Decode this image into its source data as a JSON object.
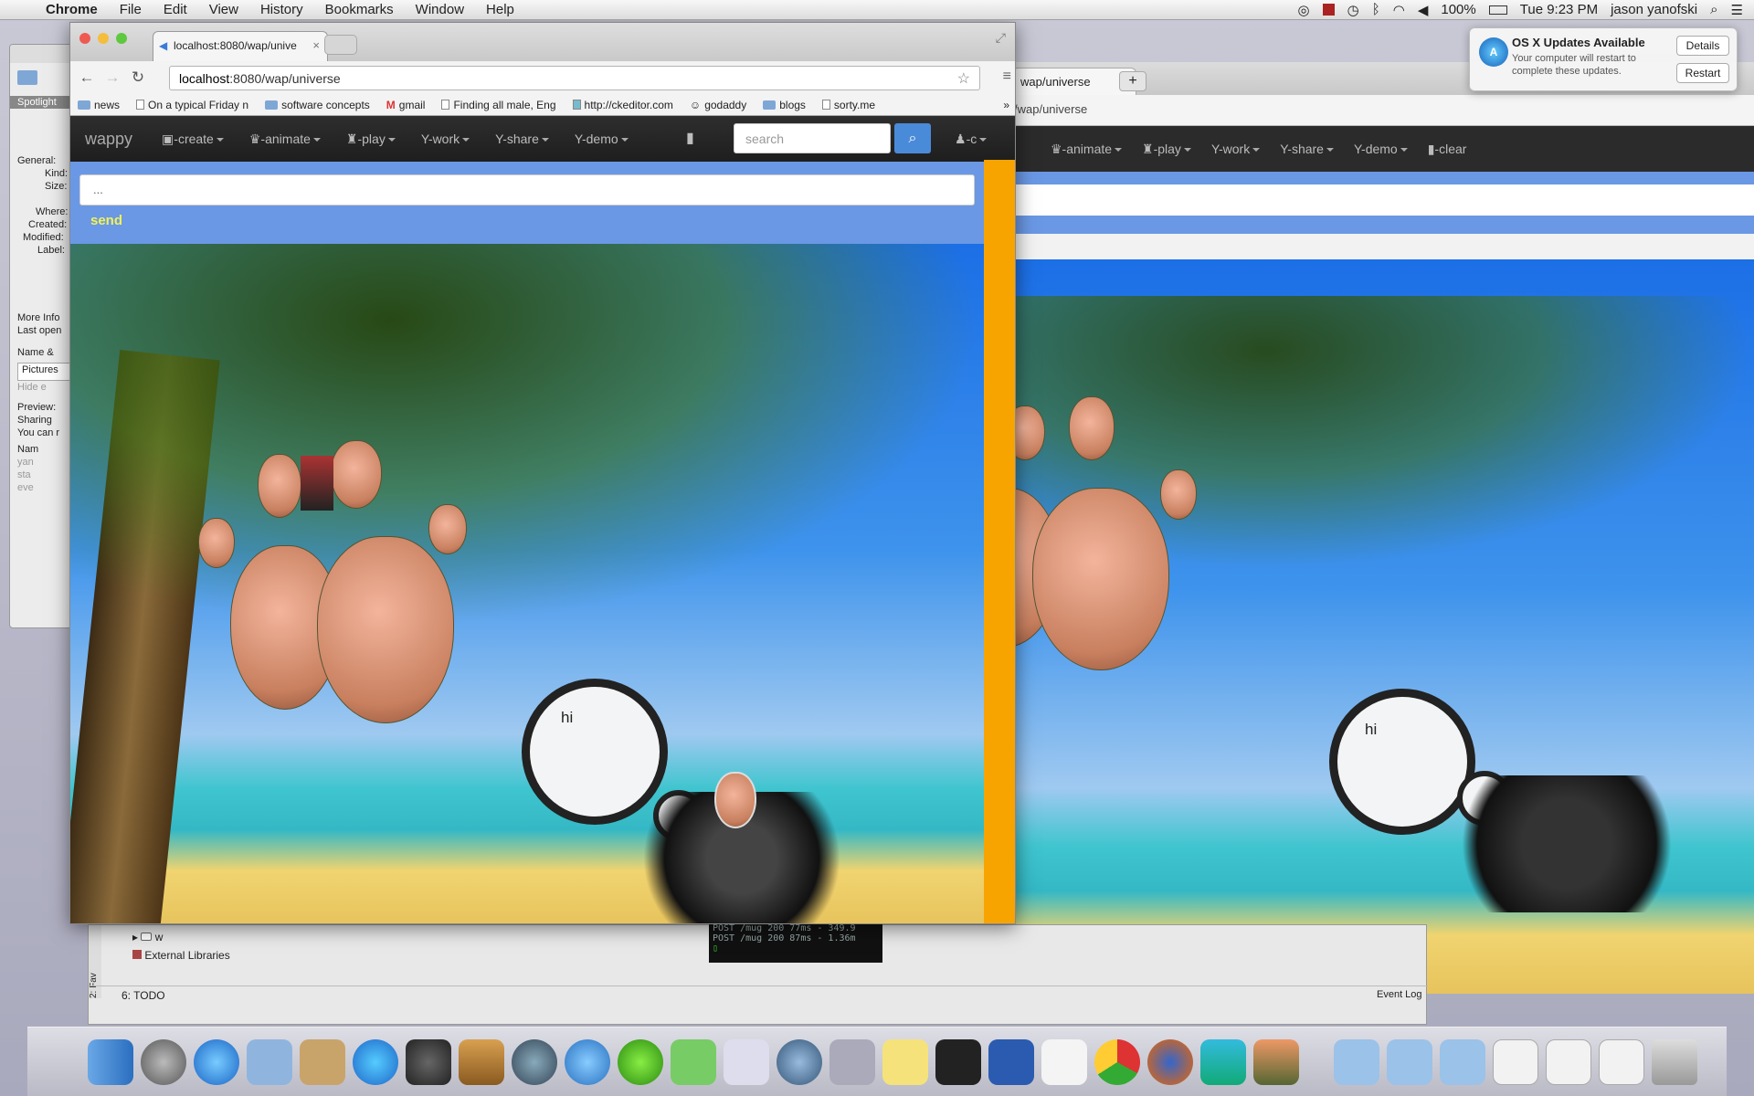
{
  "menubar": {
    "app": "Chrome",
    "items": [
      "File",
      "Edit",
      "View",
      "History",
      "Bookmarks",
      "Window",
      "Help"
    ],
    "battery": "100%",
    "clock": "Tue 9:23 PM",
    "user": "jason yanofski"
  },
  "notification": {
    "title": "OS X Updates Available",
    "body": "Your computer will restart to complete these updates.",
    "details": "Details",
    "restart": "Restart"
  },
  "infowin": {
    "lines": [
      "Spotlight",
      "General:",
      "Kind:",
      "Size:",
      "Where:",
      "Created:",
      "Modified:",
      "Label:",
      "More Info",
      "Last open",
      "Name &",
      "Pictures",
      "Hide e",
      "Preview:",
      "Sharing",
      "You can r",
      "Nam",
      "yan",
      "sta",
      "eve"
    ]
  },
  "browser": {
    "tab_title": "localhost:8080/wap/unive",
    "url_host": "localhost",
    "url_path": ":8080/wap/universe",
    "bookmarks": [
      "news",
      "On a typical Friday n",
      "software concepts",
      "gmail",
      "Finding all male, Eng",
      "http://ckeditor.com",
      "godaddy",
      "blogs",
      "sorty.me"
    ]
  },
  "app": {
    "brand": "wappy",
    "nav": [
      "create",
      "animate",
      "play",
      "work",
      "share",
      "demo"
    ],
    "search_placeholder": "search",
    "user": "c",
    "message_placeholder": "...",
    "send": "send",
    "bubble_text": "hi"
  },
  "backwin": {
    "tab_title": "wap/universe",
    "url": "/wap/universe",
    "nav": [
      "animate",
      "play",
      "work",
      "share",
      "demo",
      "clear"
    ],
    "bubble_text": "hi"
  },
  "terminal": {
    "lines": [
      "POST /mug 200 77ms - 349.9",
      "POST /mug 200 87ms - 1.36m"
    ]
  },
  "ide": {
    "tree_item": "w",
    "libraries": "External Libraries",
    "todo": "6: TODO",
    "event_log": "Event Log",
    "favorites": "2: Fav"
  },
  "dock": [
    "finder",
    "launchpad",
    "app-store",
    "mail-stamp",
    "contacts",
    "itunes",
    "imovie",
    "garageband",
    "time-machine",
    "messages",
    "green-app",
    "network",
    "preview",
    "network-utility",
    "hp-printer",
    "stickies",
    "terminal",
    "word",
    "reminders",
    "chrome",
    "firefox",
    "webstorm",
    "iphoto",
    "downloads-folder",
    "users-folder",
    "applications-folder",
    "doc-stack-1",
    "doc-stack-2",
    "doc-stack-3",
    "trash"
  ]
}
